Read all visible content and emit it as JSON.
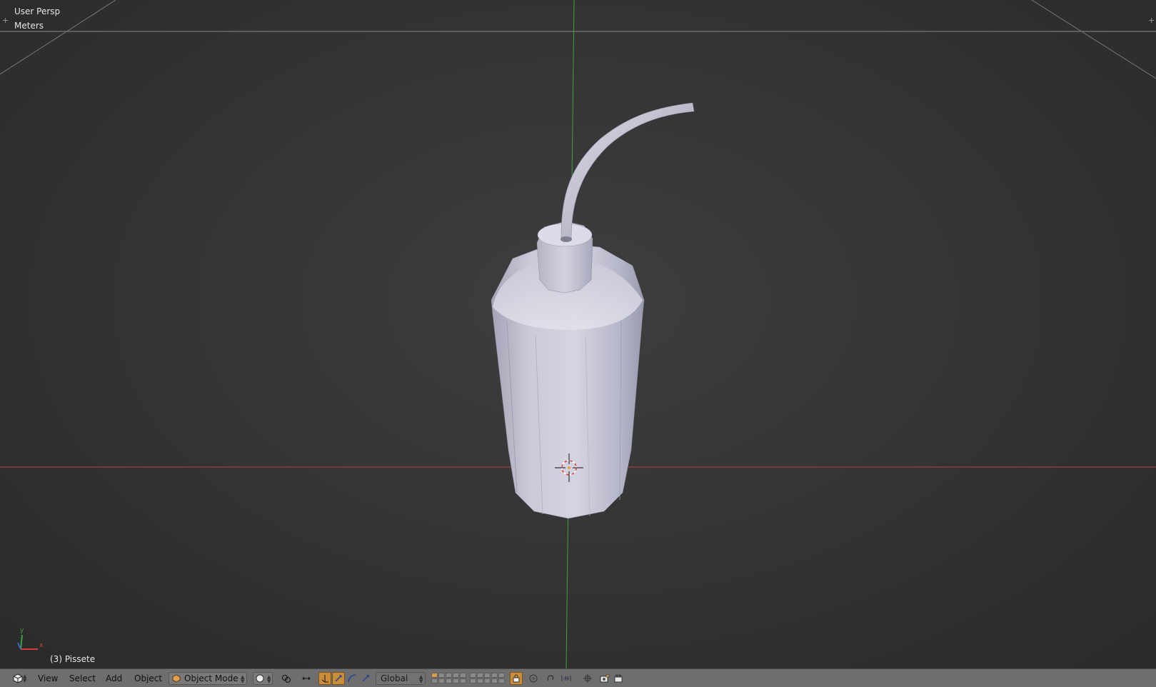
{
  "viewport": {
    "view_name": "User Persp",
    "units": "Meters",
    "object_info": "(3) Pissete",
    "axis_labels": {
      "y": "y",
      "x": "x"
    }
  },
  "header": {
    "menus": [
      "View",
      "Select",
      "Add",
      "Object"
    ],
    "mode": "Object Mode",
    "transform_orientation": "Global"
  },
  "colors": {
    "x_axis": "#b84040",
    "y_axis": "#3fa23f",
    "active_tool": "#c98e3a",
    "mesh": "#c8c8d8"
  },
  "icons": {
    "editor_type": "cube-editor-icon",
    "mode": "object-mode-icon",
    "shading": "solid-sphere-icon",
    "pivot": "pivot-point-icon",
    "manipulator": "manipulator-icon",
    "translate": "translate-icon",
    "rotate": "rotate-icon",
    "scale": "scale-icon",
    "layers": "layers-grid-icon",
    "lock": "lock-layers-icon",
    "proportional": "proportional-edit-icon",
    "snap": "snap-icon",
    "snap_element": "snap-element-icon",
    "render": "render-icon",
    "camera": "camera-icon"
  }
}
